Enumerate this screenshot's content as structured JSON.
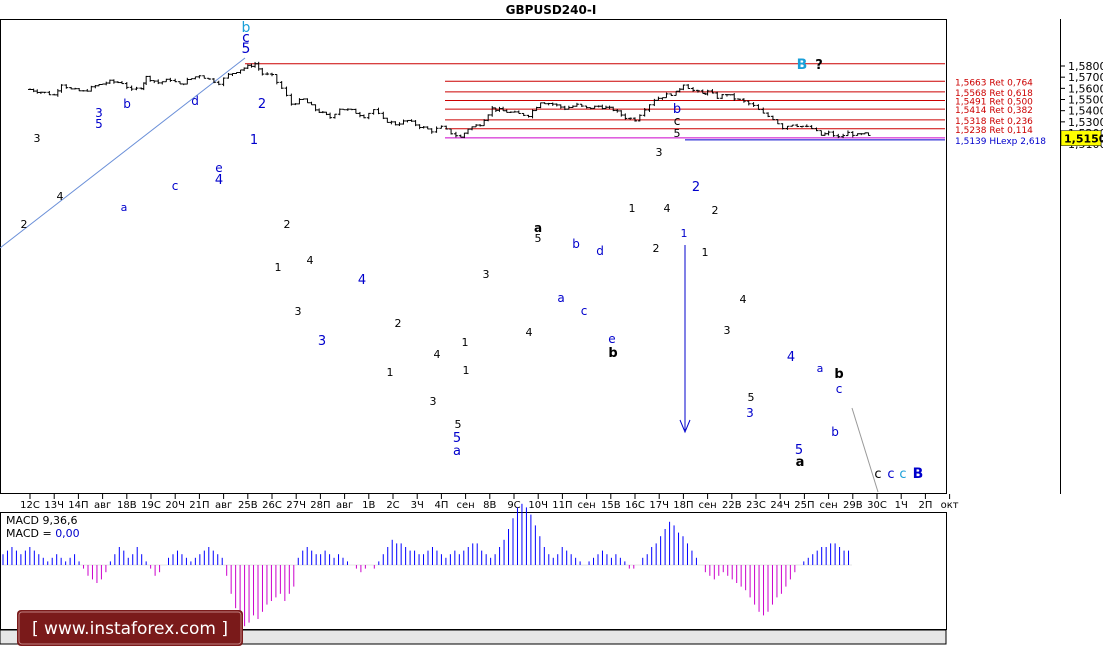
{
  "chart_title": "GBPUSD240-I",
  "current_price_label": "1,5150",
  "colors": {
    "axis": "#000000",
    "bars": "#000000",
    "fib_lines": "#cc0000",
    "fib_text": "#cc0000",
    "extension_line": "#0000cc",
    "support_line": "#cc00cc",
    "trend_line": "#6a8fd8",
    "macd_positive": "#0000ff",
    "macd_negative": "#cc00cc",
    "price_tag_bg": "#ffff00",
    "wave_black": "#000000",
    "wave_blue": "#0000cc",
    "wave_cyan": "#1a9fd8",
    "watermark": "#ffffff"
  },
  "price_axis": {
    "labels": [
      "1,5800",
      "1,5700",
      "1,5600",
      "1,5500",
      "1,5400",
      "1,5300",
      "1,5200",
      "1,5100"
    ]
  },
  "time_axis": {
    "labels": [
      "12С",
      "13Ч",
      "14П",
      "авг",
      "18В",
      "19С",
      "20Ч",
      "21П",
      "авг",
      "25В",
      "26С",
      "27Ч",
      "28П",
      "авг",
      "1В",
      "2С",
      "3Ч",
      "4П",
      "сен",
      "8В",
      "9С",
      "10Ч",
      "11П",
      "сен",
      "15В",
      "16С",
      "17Ч",
      "18П",
      "сен",
      "22В",
      "23С",
      "24Ч",
      "25П",
      "сен",
      "29В",
      "30С",
      "1Ч",
      "2П",
      "окт"
    ]
  },
  "fib_levels": [
    {
      "price": 1.5663,
      "label": "1,5663 Ret 0,764"
    },
    {
      "price": 1.5568,
      "label": "1,5568 Ret 0,618"
    },
    {
      "price": 1.5491,
      "label": "1,5491 Ret 0,500"
    },
    {
      "price": 1.5414,
      "label": "1,5414 Ret 0,382"
    },
    {
      "price": 1.5318,
      "label": "1,5318 Ret 0,236"
    },
    {
      "price": 1.5238,
      "label": "1,5238 Ret 0,114"
    }
  ],
  "top_level": {
    "price": 1.582
  },
  "extension_level": {
    "price": 1.5139,
    "label": "1,5139 HLexp 2,618"
  },
  "support_level": {
    "price": 1.5156
  },
  "macd": {
    "label_line1": "MACD 9,36,6",
    "label_line2_prefix": "MACD = ",
    "label_line2_value": "0,00"
  },
  "watermark_text": "[ www.instaforex.com ]",
  "wave_labels": [
    {
      "text": "b",
      "color": "cyan"
    },
    {
      "text": "c",
      "color": "blue"
    },
    {
      "text": "5",
      "color": "blue"
    },
    {
      "text": "2",
      "color": "blue"
    },
    {
      "text": "1",
      "color": "blue"
    },
    {
      "text": "3",
      "color": "blue"
    },
    {
      "text": "5",
      "color": "blue"
    },
    {
      "text": "b",
      "color": "blue"
    },
    {
      "text": "d",
      "color": "blue"
    },
    {
      "text": "c",
      "color": "blue"
    },
    {
      "text": "e",
      "color": "blue"
    },
    {
      "text": "4",
      "color": "blue"
    },
    {
      "text": "a",
      "color": "blue"
    },
    {
      "text": "3",
      "color": "black"
    },
    {
      "text": "2",
      "color": "black"
    },
    {
      "text": "4",
      "color": "black"
    },
    {
      "text": "2",
      "color": "black"
    },
    {
      "text": "1",
      "color": "black"
    },
    {
      "text": "4",
      "color": "black"
    },
    {
      "text": "3",
      "color": "black"
    },
    {
      "text": "3",
      "color": "blue"
    },
    {
      "text": "4",
      "color": "blue"
    },
    {
      "text": "2",
      "color": "black"
    },
    {
      "text": "1",
      "color": "black"
    },
    {
      "text": "4",
      "color": "black"
    },
    {
      "text": "1",
      "color": "black"
    },
    {
      "text": "3",
      "color": "black"
    },
    {
      "text": "5",
      "color": "black"
    },
    {
      "text": "5",
      "color": "blue"
    },
    {
      "text": "a",
      "color": "blue"
    },
    {
      "text": "1",
      "color": "black"
    },
    {
      "text": "3",
      "color": "black"
    },
    {
      "text": "4",
      "color": "black"
    },
    {
      "text": "a",
      "color": "black"
    },
    {
      "text": "5",
      "color": "black"
    },
    {
      "text": "b",
      "color": "blue"
    },
    {
      "text": "a",
      "color": "blue"
    },
    {
      "text": "d",
      "color": "blue"
    },
    {
      "text": "c",
      "color": "blue"
    },
    {
      "text": "e",
      "color": "blue"
    },
    {
      "text": "b",
      "color": "black"
    },
    {
      "text": "1",
      "color": "black"
    },
    {
      "text": "3",
      "color": "black"
    },
    {
      "text": "4",
      "color": "black"
    },
    {
      "text": "2",
      "color": "black"
    },
    {
      "text": "b",
      "color": "blue"
    },
    {
      "text": "c",
      "color": "black"
    },
    {
      "text": "5",
      "color": "black"
    },
    {
      "text": "2",
      "color": "blue"
    },
    {
      "text": "1",
      "color": "blue"
    },
    {
      "text": "2",
      "color": "black"
    },
    {
      "text": "1",
      "color": "black"
    },
    {
      "text": "4",
      "color": "black"
    },
    {
      "text": "3",
      "color": "black"
    },
    {
      "text": "5",
      "color": "black"
    },
    {
      "text": "3",
      "color": "blue"
    },
    {
      "text": "4",
      "color": "blue"
    },
    {
      "text": "5",
      "color": "blue"
    },
    {
      "text": "a",
      "color": "black"
    },
    {
      "text": "a",
      "color": "blue"
    },
    {
      "text": "b",
      "color": "black"
    },
    {
      "text": "c",
      "color": "blue"
    },
    {
      "text": "b",
      "color": "blue"
    },
    {
      "text": "B",
      "color": "cyan"
    },
    {
      "text": "?",
      "color": "black"
    },
    {
      "text": "c",
      "color": "black"
    },
    {
      "text": "c",
      "color": "blue"
    },
    {
      "text": "c",
      "color": "cyan"
    },
    {
      "text": "B",
      "color": "blue"
    }
  ],
  "chart_data": {
    "type": "bar",
    "title": "GBPUSD240-I",
    "symbol": "GBPUSD",
    "timeframe": "H4",
    "ylim": [
      1.5045,
      1.591
    ],
    "x": [
      "12С",
      "13Ч",
      "14П",
      "авг",
      "18В",
      "19С",
      "20Ч",
      "21П",
      "авг",
      "25В",
      "26С",
      "27Ч",
      "28П",
      "авг",
      "1В",
      "2С",
      "3Ч",
      "4П",
      "сен",
      "8В",
      "9С",
      "10Ч",
      "11П",
      "сен",
      "15В",
      "16С",
      "17Ч",
      "18П",
      "сен",
      "22В",
      "23С",
      "24Ч",
      "25П",
      "сен",
      "29В",
      "30С",
      "1Ч",
      "2П",
      "окт"
    ],
    "close_path": [
      [
        0,
        1.559
      ],
      [
        0.6,
        1.556
      ],
      [
        1.0,
        1.554
      ],
      [
        1.3,
        1.564
      ],
      [
        1.7,
        1.559
      ],
      [
        2.2,
        1.557
      ],
      [
        2.7,
        1.562
      ],
      [
        3.3,
        1.566
      ],
      [
        3.8,
        1.565
      ],
      [
        4.2,
        1.558
      ],
      [
        4.6,
        1.561
      ],
      [
        4.8,
        1.57
      ],
      [
        5.3,
        1.565
      ],
      [
        5.8,
        1.568
      ],
      [
        6.2,
        1.563
      ],
      [
        6.5,
        1.567
      ],
      [
        7.0,
        1.572
      ],
      [
        7.4,
        1.568
      ],
      [
        7.8,
        1.565
      ],
      [
        8.2,
        1.572
      ],
      [
        8.7,
        1.577
      ],
      [
        9.3,
        1.582
      ],
      [
        9.6,
        1.573
      ],
      [
        10.0,
        1.571
      ],
      [
        10.4,
        1.56
      ],
      [
        10.8,
        1.546
      ],
      [
        11.3,
        1.55
      ],
      [
        11.8,
        1.541
      ],
      [
        12.4,
        1.534
      ],
      [
        12.8,
        1.542
      ],
      [
        13.3,
        1.54
      ],
      [
        13.8,
        1.535
      ],
      [
        14.2,
        1.541
      ],
      [
        14.6,
        1.532
      ],
      [
        15.1,
        1.528
      ],
      [
        15.6,
        1.531
      ],
      [
        16.1,
        1.526
      ],
      [
        16.6,
        1.522
      ],
      [
        17.0,
        1.525
      ],
      [
        17.4,
        1.52
      ],
      [
        17.8,
        1.516
      ],
      [
        18.1,
        1.524
      ],
      [
        18.6,
        1.528
      ],
      [
        19.1,
        1.542
      ],
      [
        19.7,
        1.539
      ],
      [
        20.2,
        1.537
      ],
      [
        20.6,
        1.536
      ],
      [
        21.1,
        1.548
      ],
      [
        21.6,
        1.546
      ],
      [
        22.1,
        1.542
      ],
      [
        22.6,
        1.545
      ],
      [
        23.0,
        1.542
      ],
      [
        23.5,
        1.544
      ],
      [
        24.1,
        1.541
      ],
      [
        24.6,
        1.534
      ],
      [
        25.0,
        1.532
      ],
      [
        25.4,
        1.542
      ],
      [
        25.8,
        1.55
      ],
      [
        26.3,
        1.554
      ],
      [
        26.7,
        1.556
      ],
      [
        27.0,
        1.564
      ],
      [
        27.4,
        1.558
      ],
      [
        27.8,
        1.555
      ],
      [
        28.0,
        1.557
      ],
      [
        28.4,
        1.552
      ],
      [
        28.8,
        1.555
      ],
      [
        29.1,
        1.551
      ],
      [
        29.5,
        1.548
      ],
      [
        29.9,
        1.544
      ],
      [
        30.3,
        1.537
      ],
      [
        30.7,
        1.533
      ],
      [
        31.1,
        1.525
      ],
      [
        31.5,
        1.528
      ],
      [
        31.9,
        1.526
      ],
      [
        32.3,
        1.524
      ],
      [
        32.7,
        1.518
      ],
      [
        33.0,
        1.52
      ],
      [
        33.4,
        1.516
      ],
      [
        33.8,
        1.52
      ],
      [
        34.2,
        1.518
      ],
      [
        34.5,
        1.519
      ],
      [
        34.8,
        1.515
      ]
    ],
    "levels": [
      {
        "price": 1.5663,
        "name": "Ret 0,764"
      },
      {
        "price": 1.5568,
        "name": "Ret 0,618"
      },
      {
        "price": 1.5491,
        "name": "Ret 0,500"
      },
      {
        "price": 1.5414,
        "name": "Ret 0,382"
      },
      {
        "price": 1.5318,
        "name": "Ret 0,236"
      },
      {
        "price": 1.5238,
        "name": "Ret 0,114"
      },
      {
        "price": 1.5139,
        "name": "HLexp 2,618"
      }
    ],
    "last_price": 1.515,
    "macd_values": [
      0.3,
      0.4,
      0.5,
      0.4,
      0.3,
      0.4,
      0.5,
      0.4,
      0.3,
      0.2,
      0.1,
      0.2,
      0.3,
      0.2,
      0.1,
      0.2,
      0.3,
      0.1,
      -0.1,
      -0.3,
      -0.4,
      -0.5,
      -0.4,
      -0.2,
      0.1,
      0.3,
      0.5,
      0.4,
      0.2,
      0.3,
      0.5,
      0.3,
      0.1,
      -0.1,
      -0.3,
      -0.2,
      0.0,
      0.2,
      0.3,
      0.4,
      0.3,
      0.2,
      0.1,
      0.2,
      0.3,
      0.4,
      0.5,
      0.4,
      0.3,
      0.2,
      -0.3,
      -0.8,
      -1.2,
      -1.5,
      -1.7,
      -1.6,
      -1.4,
      -1.5,
      -1.3,
      -1.1,
      -1.0,
      -0.9,
      -0.8,
      -1.0,
      -0.8,
      -0.6,
      0.2,
      0.4,
      0.5,
      0.4,
      0.3,
      0.3,
      0.4,
      0.3,
      0.2,
      0.3,
      0.2,
      0.1,
      0.0,
      -0.1,
      -0.2,
      -0.1,
      0.0,
      -0.1,
      0.1,
      0.3,
      0.5,
      0.7,
      0.6,
      0.6,
      0.5,
      0.4,
      0.4,
      0.3,
      0.3,
      0.4,
      0.5,
      0.4,
      0.3,
      0.2,
      0.3,
      0.4,
      0.3,
      0.4,
      0.5,
      0.6,
      0.6,
      0.4,
      0.3,
      0.2,
      0.3,
      0.5,
      0.7,
      1.0,
      1.3,
      1.6,
      1.7,
      1.6,
      1.4,
      1.1,
      0.8,
      0.5,
      0.3,
      0.2,
      0.3,
      0.5,
      0.4,
      0.3,
      0.2,
      0.1,
      0.0,
      0.1,
      0.2,
      0.3,
      0.4,
      0.3,
      0.2,
      0.3,
      0.2,
      0.1,
      -0.1,
      -0.1,
      0.0,
      0.2,
      0.3,
      0.5,
      0.6,
      0.8,
      1.0,
      1.2,
      1.1,
      0.9,
      0.8,
      0.6,
      0.4,
      0.2,
      0.0,
      -0.2,
      -0.3,
      -0.4,
      -0.3,
      -0.2,
      -0.3,
      -0.4,
      -0.5,
      -0.6,
      -0.7,
      -0.9,
      -1.1,
      -1.3,
      -1.4,
      -1.3,
      -1.1,
      -0.9,
      -0.8,
      -0.6,
      -0.4,
      -0.2,
      0.0,
      0.1,
      0.2,
      0.3,
      0.4,
      0.5,
      0.5,
      0.6,
      0.6,
      0.5,
      0.4,
      0.4
    ]
  }
}
